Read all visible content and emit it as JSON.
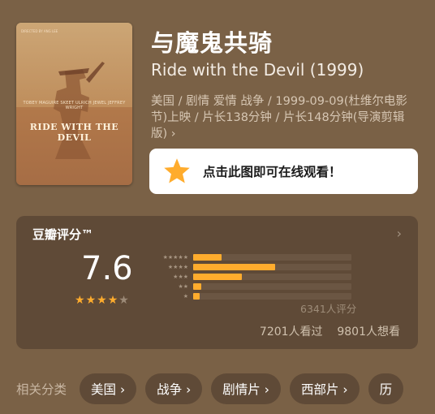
{
  "movie": {
    "title": "与魔鬼共骑",
    "original_title": "Ride with the Devil (1999)",
    "meta": "美国 / 剧情 爱情 战争 / 1999-09-09(杜维尔电影节)上映 / 片长138分钟 / 片长148分钟(导演剪辑版) ›"
  },
  "poster": {
    "title_text": "RIDE WITH THE DEVIL",
    "cast_text": "TOBEY MAGUIRE  SKEET ULRICH  JEWEL  JEFFREY WRIGHT",
    "top_text": "DIRECTED BY ANG LEE"
  },
  "watch_banner": {
    "text": "点击此图即可在线观看！",
    "icon": "star-icon"
  },
  "rating": {
    "label": "豆瓣评分™",
    "score": "7.6",
    "star_level": 4,
    "distribution": [
      {
        "stars": 5,
        "fraction": 0.18
      },
      {
        "stars": 4,
        "fraction": 0.52
      },
      {
        "stars": 3,
        "fraction": 0.31
      },
      {
        "stars": 2,
        "fraction": 0.05
      },
      {
        "stars": 1,
        "fraction": 0.04
      }
    ],
    "ratings_count": "6341人评分",
    "watched": "7201人看过",
    "want": "9801人想看",
    "arrow": "›"
  },
  "tags": {
    "label": "相关分类",
    "items": [
      "美国 ›",
      "战争 ›",
      "剧情片 ›",
      "西部片 ›",
      "历"
    ]
  },
  "colors": {
    "accent": "#ffac2d",
    "background": "#7a6146",
    "card": "#5f4a37"
  }
}
